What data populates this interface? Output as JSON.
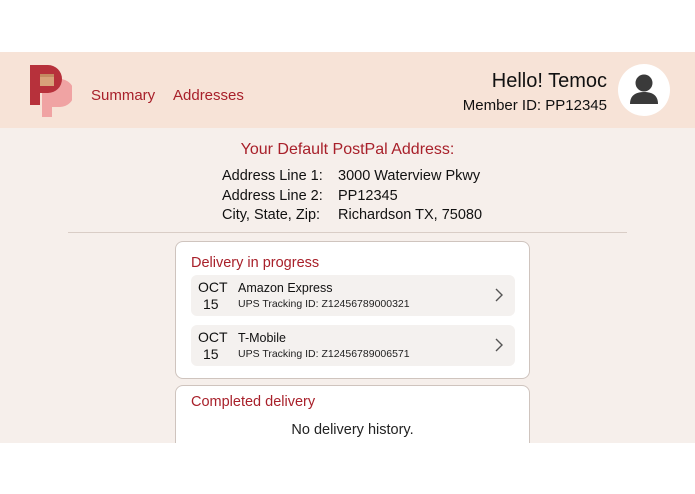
{
  "colors": {
    "accent": "#a8202a",
    "header_bg": "#f7e3d7",
    "page_bg": "#f6efeb",
    "logo_dark": "#b7313b",
    "logo_light": "#f0a3a3"
  },
  "header": {
    "nav": {
      "summary": "Summary",
      "addresses": "Addresses"
    },
    "greeting": "Hello! Temoc",
    "member_id": "Member ID: PP12345",
    "logo_icon": "postpal-logo",
    "avatar_icon": "user-avatar-icon"
  },
  "default_address": {
    "title": "Your Default PostPal Address:",
    "rows": [
      {
        "label": "Address Line 1:",
        "value": "3000 Waterview Pkwy"
      },
      {
        "label": "Address Line 2:",
        "value": "PP12345"
      },
      {
        "label": "City, State, Zip:",
        "value": "Richardson TX, 75080"
      }
    ]
  },
  "in_progress": {
    "title": "Delivery in progress",
    "items": [
      {
        "month": "OCT",
        "day": "15",
        "name": "Amazon Express",
        "tracking": "UPS Tracking ID: Z12456789000321"
      },
      {
        "month": "OCT",
        "day": "15",
        "name": "T-Mobile",
        "tracking": "UPS Tracking ID: Z12456789006571"
      }
    ]
  },
  "completed": {
    "title": "Completed delivery",
    "empty_text": "No delivery history."
  }
}
